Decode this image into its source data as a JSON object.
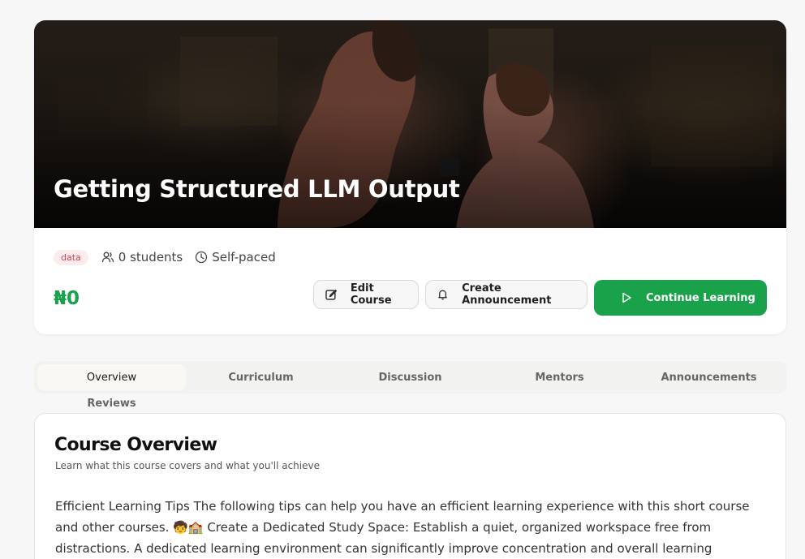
{
  "course": {
    "title": "Getting Structured LLM Output",
    "tag": "data",
    "students": "0 students",
    "pace": "Self-paced",
    "price": "₦0"
  },
  "actions": {
    "edit": "Edit Course",
    "announce": "Create Announcement",
    "continue": "Continue Learning"
  },
  "tabs": [
    "Overview",
    "Curriculum",
    "Discussion",
    "Mentors",
    "Announcements",
    "Reviews"
  ],
  "overview": {
    "title": "Course Overview",
    "subtitle": "Learn what this course covers and what you'll achieve",
    "body": "Efficient Learning Tips The following tips can help you have an efficient learning experience with this short course and other courses. 🧒🏫 Create a Dedicated Study Space: Establish a quiet, organized workspace free from distractions. A dedicated learning environment can significantly improve concentration and overall learning efficiency. 📅 Develop a Consistent"
  },
  "colors": {
    "accent": "#1aa24a",
    "tag_bg": "#fdecee",
    "tag_text": "#d0434f"
  },
  "icons": {
    "students": "users-icon",
    "pace": "clock-icon",
    "edit": "edit-icon",
    "announce": "bell-icon",
    "continue": "play-icon"
  }
}
